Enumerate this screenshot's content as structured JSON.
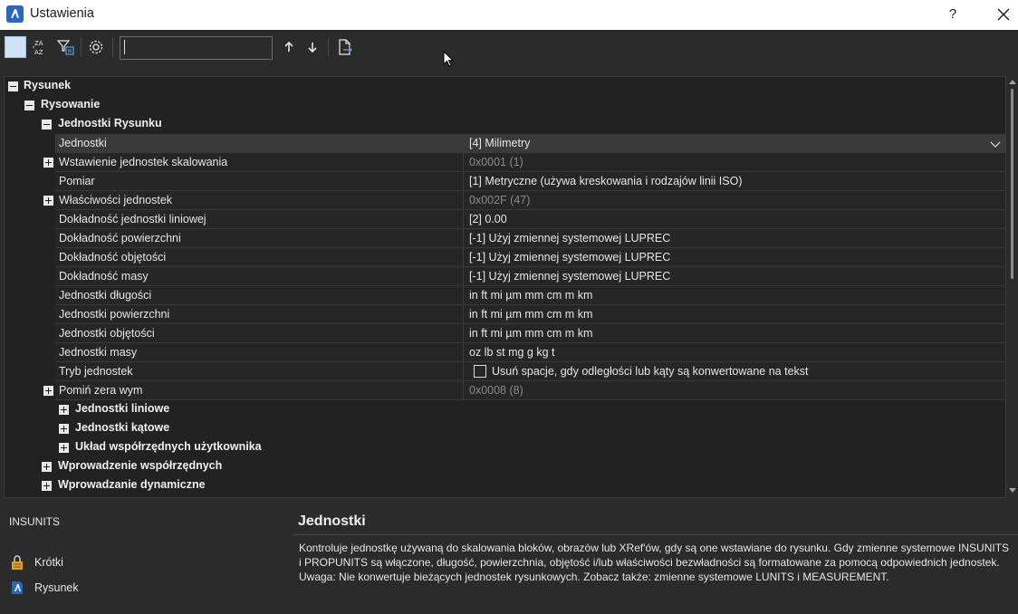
{
  "window": {
    "title": "Ustawienia",
    "help_label": "?"
  },
  "toolbar": {
    "search_value": ""
  },
  "tree": {
    "rysunek": "Rysunek",
    "rysowanie": "Rysowanie",
    "jednostki_rysunku": "Jednostki Rysunku",
    "props": [
      {
        "name": "Jednostki",
        "value": "[4] Milimetry"
      },
      {
        "name": "Wstawienie jednostek skalowania",
        "value": "0x0001 (1)"
      },
      {
        "name": "Pomiar",
        "value": "[1] Metryczne (używa kreskowania i rodzajów linii ISO)"
      },
      {
        "name": "Właściwości jednostek",
        "value": "0x002F (47)"
      },
      {
        "name": "Dokładność jednostki liniowej",
        "value": "[2] 0.00"
      },
      {
        "name": "Dokładność powierzchni",
        "value": "[-1] Użyj zmiennej systemowej LUPREC"
      },
      {
        "name": "Dokładność objętości",
        "value": "[-1] Użyj zmiennej systemowej LUPREC"
      },
      {
        "name": "Dokładność masy",
        "value": "[-1] Użyj zmiennej systemowej LUPREC"
      },
      {
        "name": "Jednostki długości",
        "value": "in ft mi µm mm cm m km"
      },
      {
        "name": "Jednostki powierzchni",
        "value": "in ft mi µm mm cm m km"
      },
      {
        "name": "Jednostki objętości",
        "value": "in ft mi µm mm cm m km"
      },
      {
        "name": "Jednostki masy",
        "value": "oz lb st mg g kg t"
      },
      {
        "name": "Tryb jednostek",
        "value": "Usuń spacje, gdy odległości lub kąty są konwertowane na tekst"
      },
      {
        "name": "Pomiń zera wym",
        "value": "0x0008 (8)"
      }
    ],
    "jednostki_liniowe": "Jednostki liniowe",
    "jednostki_katowe": "Jednostki kątowe",
    "uklad_wspolrzednych": "Układ współrzędnych użytkownika",
    "wprowadzenie_wspolrzednych": "Wprowadzenie współrzędnych",
    "wprowadzanie_dynamiczne": "Wprowadzanie dynamiczne"
  },
  "bottom": {
    "variable_name": "INSUNITS",
    "scope_short": "Krótki",
    "scope_drawing": "Rysunek",
    "title": "Jednostki",
    "description_1": "Kontroluje jednostkę używaną do skalowania bloków, obrazów lub XRef'ów, gdy są one wstawiane do rysunku. Gdy zmienne systemowe INSUNITS i PROPUNITS są włączone, długość, powierzchnia, objętość i/lub właściwości bezwładności są formatowane za pomocą odpowiednich jednostek.",
    "description_2": "Uwaga: Nie konwertuje bieżących jednostek rysunkowych. Zobacz także: zmienne systemowe LUNITS i MEASUREMENT."
  }
}
